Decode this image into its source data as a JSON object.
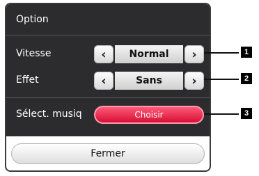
{
  "dialog": {
    "title": "Option",
    "rows": [
      {
        "label": "Vitesse",
        "value": "Normal"
      },
      {
        "label": "Effet",
        "value": "Sans"
      }
    ],
    "music": {
      "label": "Sélect. musiq",
      "button": "Choisir"
    },
    "close_button": "Fermer"
  },
  "callouts": [
    "1",
    "2",
    "3"
  ],
  "icons": {
    "left": "‹",
    "right": "›"
  }
}
